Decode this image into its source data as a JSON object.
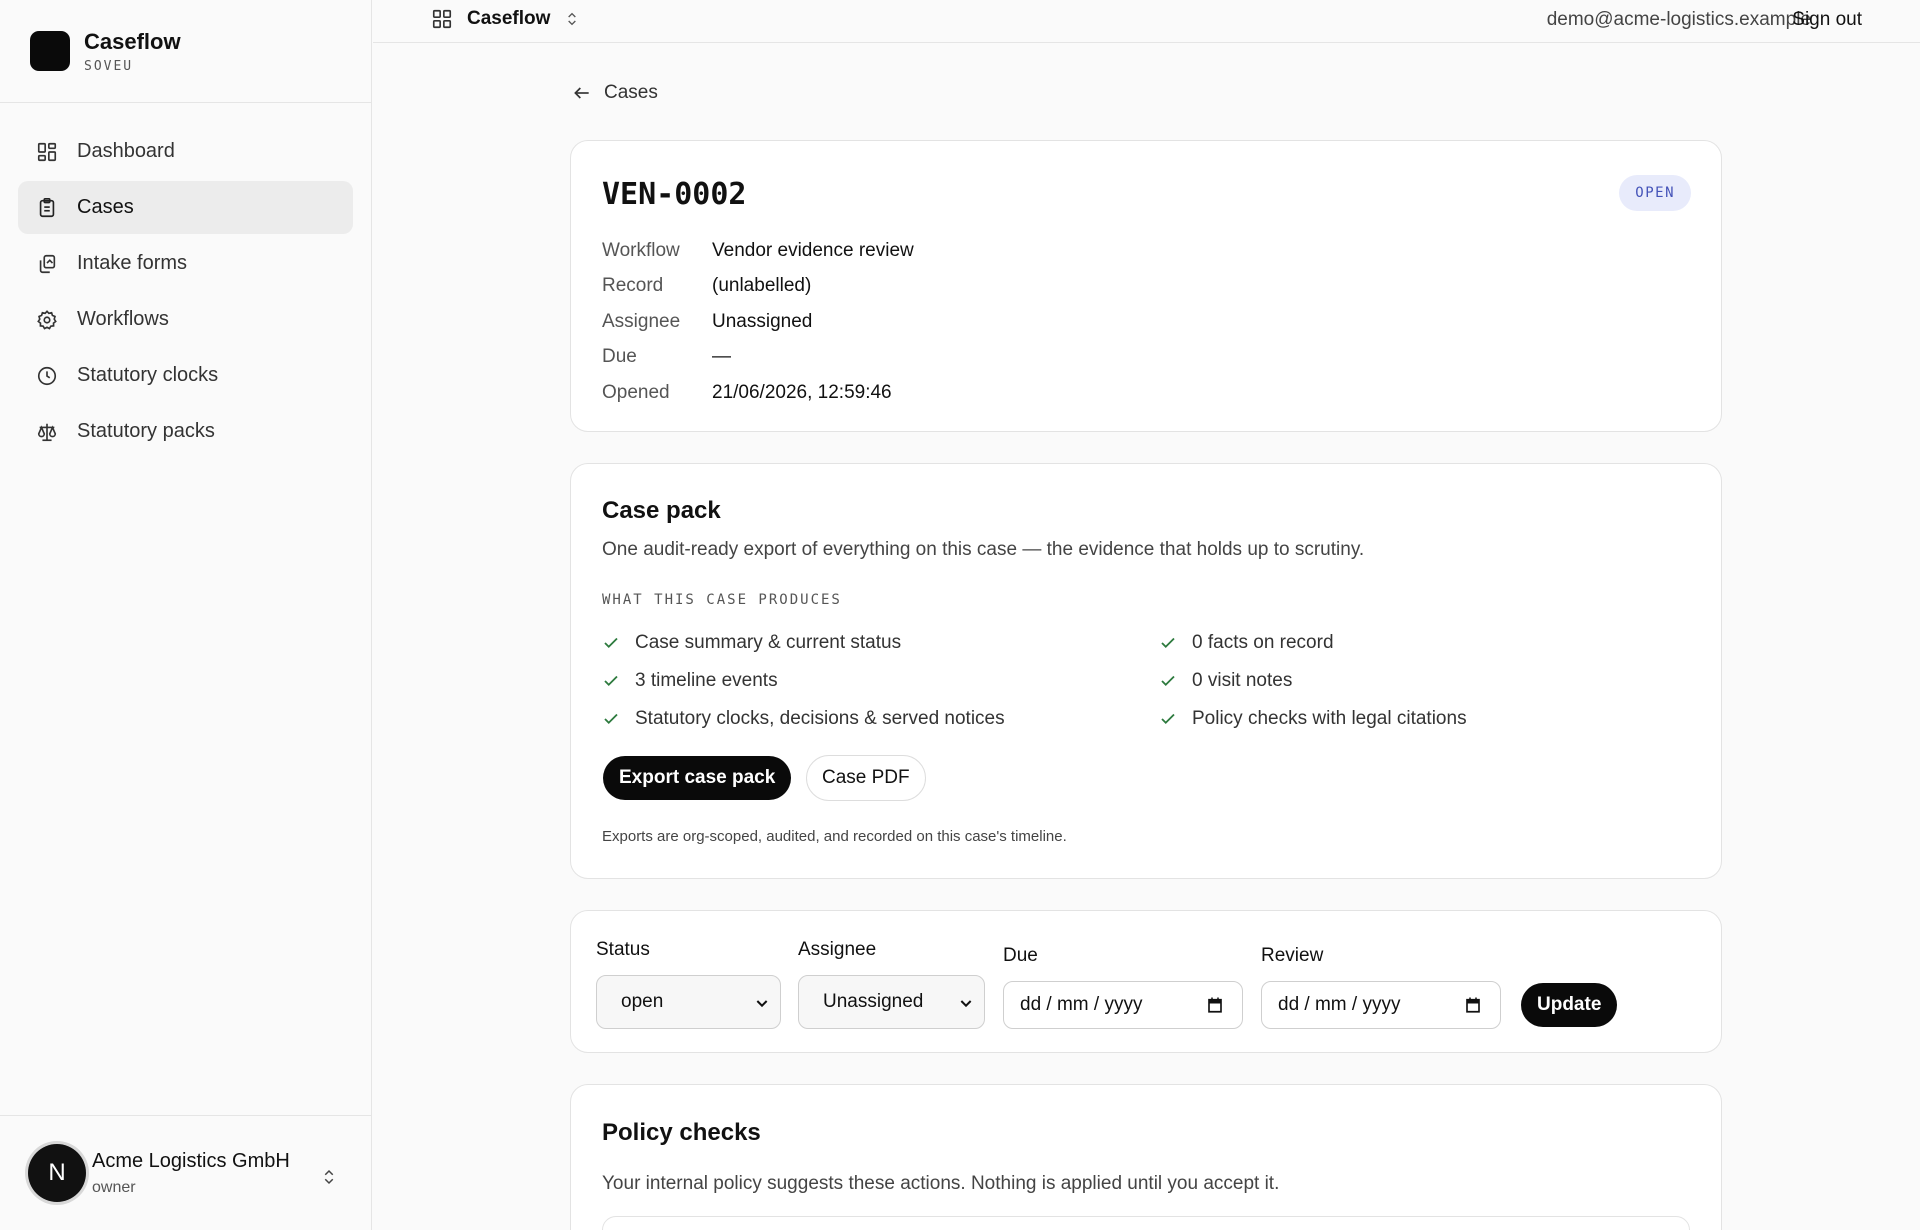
{
  "brand": {
    "name": "Caseflow",
    "sub": "SOVEU"
  },
  "nav": [
    {
      "label": "Dashboard",
      "icon": "dashboard-icon"
    },
    {
      "label": "Cases",
      "icon": "clipboard-icon",
      "active": true
    },
    {
      "label": "Intake forms",
      "icon": "copy-icon"
    },
    {
      "label": "Workflows",
      "icon": "gear-icon"
    },
    {
      "label": "Statutory clocks",
      "icon": "clock-icon"
    },
    {
      "label": "Statutory packs",
      "icon": "scale-icon"
    }
  ],
  "org": {
    "initial": "N",
    "name": "Acme Logistics GmbH",
    "role": "owner"
  },
  "topbar": {
    "app_name": "Caseflow",
    "email": "demo@acme-logistics.example",
    "sign_out": "Sign out"
  },
  "back_label": "Cases",
  "case": {
    "id": "VEN-0002",
    "status": "OPEN",
    "meta": [
      {
        "k": "Workflow",
        "v": "Vendor evidence review"
      },
      {
        "k": "Record",
        "v": "(unlabelled)"
      },
      {
        "k": "Assignee",
        "v": "Unassigned"
      },
      {
        "k": "Due",
        "v": "—"
      },
      {
        "k": "Opened",
        "v": "21/06/2026, 12:59:46"
      }
    ]
  },
  "case_pack": {
    "title": "Case pack",
    "description": "One audit-ready export of everything on this case — the evidence that holds up to scrutiny.",
    "eyebrow": "WHAT THIS CASE PRODUCES",
    "left_items": [
      "Case summary & current status",
      "3 timeline events",
      "Statutory clocks, decisions & served notices"
    ],
    "right_items": [
      "0 facts on record",
      "0 visit notes",
      "Policy checks with legal citations"
    ],
    "export_label": "Export case pack",
    "pdf_label": "Case PDF",
    "note": "Exports are org-scoped, audited, and recorded on this case's timeline."
  },
  "update_form": {
    "status_label": "Status",
    "status_value": "open",
    "assignee_label": "Assignee",
    "assignee_value": "Unassigned",
    "due_label": "Due",
    "due_placeholder": "dd / mm / yyyy",
    "review_label": "Review",
    "review_placeholder": "dd / mm / yyyy",
    "update_label": "Update"
  },
  "policy": {
    "title": "Policy checks",
    "description": "Your internal policy suggests these actions. Nothing is applied until you accept it."
  },
  "colors": {
    "badge_bg": "#e8ebfb",
    "badge_text": "#4453b8",
    "check": "#2d7a3e",
    "primary": "#0a0a0a"
  }
}
